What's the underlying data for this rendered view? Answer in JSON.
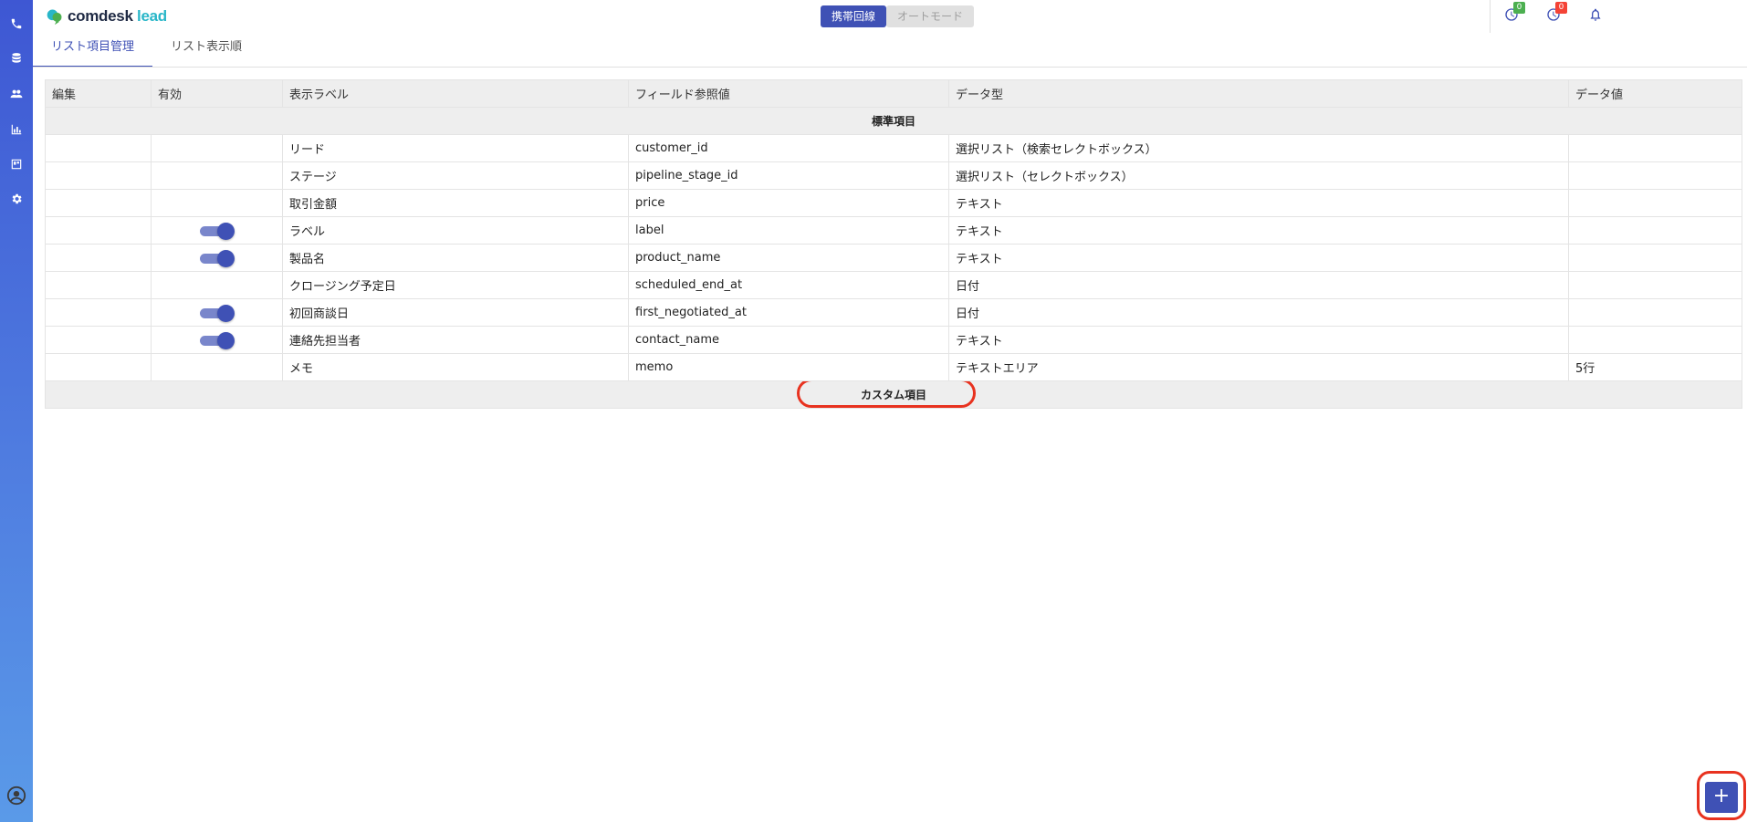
{
  "app": {
    "logo_main": "comdesk",
    "logo_accent": "lead"
  },
  "header": {
    "mode_mobile": "携帯回線",
    "mode_auto": "オートモード",
    "badge_1": "0",
    "badge_2": "0"
  },
  "tabs": [
    {
      "label": "リスト項目管理",
      "active": true
    },
    {
      "label": "リスト表示順",
      "active": false
    }
  ],
  "table": {
    "headers": [
      "編集",
      "有効",
      "表示ラベル",
      "フィールド参照値",
      "データ型",
      "データ値"
    ],
    "section_standard": "標準項目",
    "section_custom": "カスタム項目",
    "rows": [
      {
        "toggle": false,
        "label": "リード",
        "field": "customer_id",
        "type": "選択リスト（検索セレクトボックス）",
        "value": ""
      },
      {
        "toggle": false,
        "label": "ステージ",
        "field": "pipeline_stage_id",
        "type": "選択リスト（セレクトボックス）",
        "value": ""
      },
      {
        "toggle": false,
        "label": "取引金額",
        "field": "price",
        "type": "テキスト",
        "value": ""
      },
      {
        "toggle": true,
        "label": "ラベル",
        "field": "label",
        "type": "テキスト",
        "value": ""
      },
      {
        "toggle": true,
        "label": "製品名",
        "field": "product_name",
        "type": "テキスト",
        "value": ""
      },
      {
        "toggle": false,
        "label": "クロージング予定日",
        "field": "scheduled_end_at",
        "type": "日付",
        "value": ""
      },
      {
        "toggle": true,
        "label": "初回商談日",
        "field": "first_negotiated_at",
        "type": "日付",
        "value": ""
      },
      {
        "toggle": true,
        "label": "連絡先担当者",
        "field": "contact_name",
        "type": "テキスト",
        "value": ""
      },
      {
        "toggle": false,
        "label": "メモ",
        "field": "memo",
        "type": "テキストエリア",
        "value": "5行"
      }
    ]
  },
  "fab": {
    "label": "+"
  },
  "colors": {
    "primary": "#3f51b5",
    "highlight": "#e8321f",
    "accent_logo": "#29b6c8"
  },
  "icons": [
    "phone-icon",
    "database-icon",
    "users-icon",
    "chart-icon",
    "board-icon",
    "gear-icon",
    "user-circle-icon",
    "clock-icon",
    "bell-icon"
  ]
}
